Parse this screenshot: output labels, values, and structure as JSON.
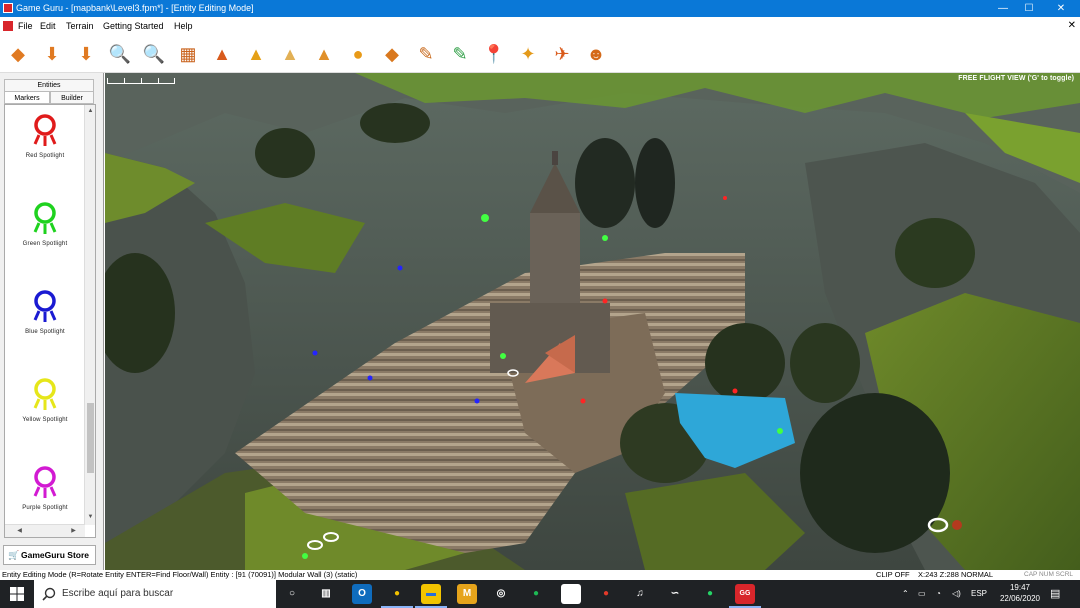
{
  "window": {
    "title": "Game Guru - [mapbank\\Level3.fpm*] - [Entity Editing Mode]",
    "controls": {
      "minimize": "—",
      "maximize": "☐",
      "close": "✕"
    }
  },
  "menu": {
    "items": [
      "File",
      "Edit",
      "Terrain",
      "Getting Started",
      "Help"
    ],
    "close_doc": "✕"
  },
  "toolbar": {
    "buttons": [
      {
        "name": "tool-1",
        "glyph": "◆",
        "color": "#e07a22"
      },
      {
        "name": "tool-2",
        "glyph": "⬇",
        "color": "#e07a22"
      },
      {
        "name": "tool-3",
        "glyph": "⬇",
        "color": "#e07a22"
      },
      {
        "name": "zoom-in",
        "glyph": "🔍",
        "color": "#d08a18"
      },
      {
        "name": "zoom-out",
        "glyph": "🔍",
        "color": "#d08a18"
      },
      {
        "name": "tool-6",
        "glyph": "▦",
        "color": "#c9621c"
      },
      {
        "name": "tool-7",
        "glyph": "▲",
        "color": "#d85a1c"
      },
      {
        "name": "tool-8",
        "glyph": "▲",
        "color": "#e5a017"
      },
      {
        "name": "tool-9",
        "glyph": "▲",
        "color": "#e2b055"
      },
      {
        "name": "tool-10",
        "glyph": "▲",
        "color": "#e0902a"
      },
      {
        "name": "tool-11",
        "glyph": "●",
        "color": "#e89a18"
      },
      {
        "name": "tool-12",
        "glyph": "◆",
        "color": "#d9781e"
      },
      {
        "name": "tool-13",
        "glyph": "✎",
        "color": "#c96a1c"
      },
      {
        "name": "tool-14",
        "glyph": "✎",
        "color": "#2e9e45"
      },
      {
        "name": "tool-15",
        "glyph": "📍",
        "color": "#e8a618"
      },
      {
        "name": "tool-16",
        "glyph": "✦",
        "color": "#e49a1a"
      },
      {
        "name": "tool-17",
        "glyph": "✈",
        "color": "#d95a1a"
      },
      {
        "name": "tool-18",
        "glyph": "☻",
        "color": "#d46a1a"
      }
    ]
  },
  "panel": {
    "header": "Entities",
    "tabs": [
      "Markers",
      "Builder"
    ],
    "items": [
      {
        "label": "Red Spotlight",
        "color": "#e01b1b"
      },
      {
        "label": "Green Spotlight",
        "color": "#1fd21f"
      },
      {
        "label": "Blue Spotlight",
        "color": "#1a1ad2"
      },
      {
        "label": "Yellow Spotlight",
        "color": "#e6e61a"
      },
      {
        "label": "Purple Spotlight",
        "color": "#d21ad2"
      }
    ],
    "store_button": "GameGuru Store",
    "scroll": {
      "up": "▲",
      "down": "▼",
      "left": "◀",
      "right": "▶"
    }
  },
  "viewport": {
    "hint": "FREE FLIGHT VIEW ('G' to toggle)"
  },
  "status": {
    "mode": "Entity Editing Mode (R=Rotate Entity  ENTER=Find Floor/Wall)  Entity : [91 (70091)] Modular Wall (3) (static)",
    "clip": "CLIP OFF",
    "coords": "X:243  Z:288 NORMAL",
    "keys": "CAP NUM SCRL"
  },
  "taskbar": {
    "search_placeholder": "Escribe aquí para buscar",
    "apps": [
      {
        "name": "cortana",
        "glyph": "○",
        "bg": "transparent",
        "fg": "#ffffff"
      },
      {
        "name": "task-view",
        "glyph": "▥",
        "bg": "transparent",
        "fg": "#ffffff"
      },
      {
        "name": "outlook",
        "glyph": "O",
        "bg": "#0f6cbd",
        "fg": "#ffffff"
      },
      {
        "name": "chrome",
        "glyph": "●",
        "bg": "transparent",
        "fg": "#f2c200"
      },
      {
        "name": "file-explorer",
        "glyph": "▬",
        "bg": "#f3c400",
        "fg": "#2a6fd6"
      },
      {
        "name": "app-m",
        "glyph": "M",
        "bg": "#e6a41b",
        "fg": "#ffffff"
      },
      {
        "name": "xbox",
        "glyph": "◎",
        "bg": "transparent",
        "fg": "#ffffff"
      },
      {
        "name": "spotify",
        "glyph": "●",
        "bg": "transparent",
        "fg": "#1db954"
      },
      {
        "name": "notepad",
        "glyph": "▯",
        "bg": "#ffffff",
        "fg": "#ffffff"
      },
      {
        "name": "app-flame",
        "glyph": "●",
        "bg": "transparent",
        "fg": "#e23a2a"
      },
      {
        "name": "itunes",
        "glyph": "♫",
        "bg": "transparent",
        "fg": "#ffffff"
      },
      {
        "name": "app-curve",
        "glyph": "∽",
        "bg": "transparent",
        "fg": "#ffffff"
      },
      {
        "name": "whatsapp",
        "glyph": "●",
        "bg": "transparent",
        "fg": "#25d366"
      },
      {
        "name": "game-guru",
        "glyph": "GG",
        "bg": "#d8262b",
        "fg": "#ffffff"
      }
    ],
    "tray": {
      "chevron": "⌃",
      "lang": "ESP",
      "time": "19:47",
      "date": "22/06/2020"
    }
  }
}
